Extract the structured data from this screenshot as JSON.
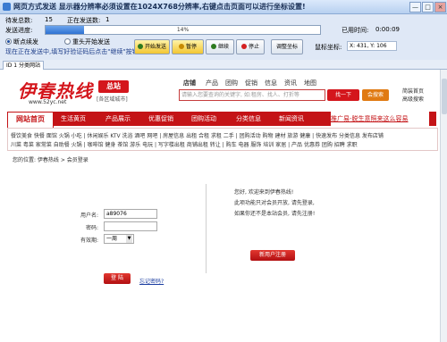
{
  "window": {
    "title": "网页方式发送 显示器分辨率必须设置在1024X768分辨率,右键点击页面可以进行坐标设置!",
    "min": "—",
    "max": "□",
    "close": "×"
  },
  "panel": {
    "pending_label": "待发总数:",
    "pending_value": "15",
    "sending_label": "正在发送数:",
    "sending_value": "1",
    "progress_label": "发送进度:",
    "progress_text": "14%",
    "progress_value": 0.14,
    "elapsed_label": "已用时间:",
    "elapsed_value": "0:00:09",
    "radio_resume": "断点续发",
    "radio_restart": "重头开始发送",
    "radio_resume_selected": true,
    "tip": "现在正在发送中,填写好验证码后点击\"继续\"按钮",
    "btn_start": "开始发送",
    "btn_pause": "暂停",
    "btn_continue": "继续",
    "btn_stop": "停止",
    "btn_adjust": "调整坐标",
    "mouse_label": "鼠标坐标:",
    "mouse_value": "X: 431, Y: 106"
  },
  "tabs": {
    "active": "ID 1 分类网站"
  },
  "site": {
    "logo": "伊春热线",
    "url": "www.52yc.net",
    "badge": "总站",
    "badge_sub": "[各区域城市]",
    "nav": [
      "店铺",
      "产品",
      "团购",
      "促销",
      "信息",
      "资讯",
      "地图"
    ],
    "search_placeholder": "请输入您要查询的关键字, 如:租房、找人、打折等",
    "btn_find": "找一下",
    "btn_mall": "会搜索",
    "right_links": [
      "简装首页",
      "高级搜索"
    ],
    "red_nav": [
      "网站首页",
      "生活黄页",
      "产品展示",
      "优惠促销",
      "团购活动",
      "分类信息",
      "新闻资讯"
    ],
    "promo": "推广易-脱生意照来这么容易",
    "cat_row1": "餐饮美食 快餐 面馆 火锅 小吃 | 休闲娱乐 KTV 洗浴 酒吧 网吧 | 房屋信息 出租 合租 求租 二手 | 团购活动 购物 建材 旅游 健康 | 快速发布 分类信息 发布店铺",
    "cat_row2": "川菜 粤菜 家常菜 自助餐 火锅 | 咖啡馆 健身 茶馆 游乐 电玩 | 写字楼出租 商铺出租 转让 | 购车 电器 服饰 培训 家居 | 产品 优惠券 团购 招聘 求职",
    "breadcrumb": "您的位置: 伊春热线 > 会员登录"
  },
  "login": {
    "username_label": "用户名:",
    "username_value": "a89076",
    "password_label": "密码:",
    "password_value": "",
    "expire_label": "有效期:",
    "expire_value": "一周",
    "btn_login": "登 陆",
    "forgot": "忘记密码?"
  },
  "register": {
    "line1": "您好, 欢迎来到伊春热线!",
    "line2": "此项功能只对会员开放, 请先登录,",
    "line3": "如果你还不是本站会员, 请先注册!",
    "btn_register": "新用户注册"
  }
}
